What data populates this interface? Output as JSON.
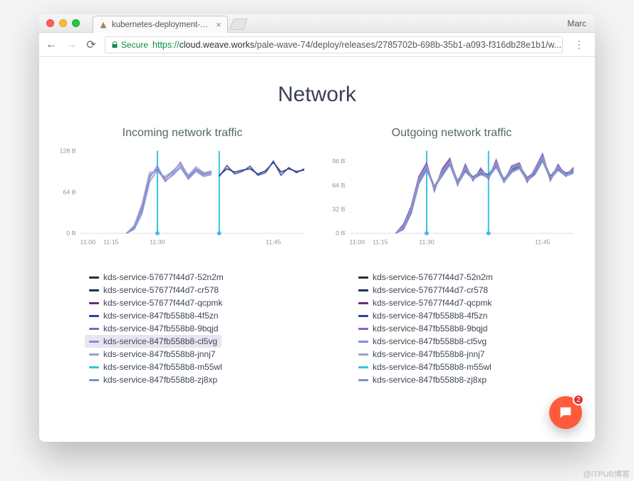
{
  "browser": {
    "user": "Marc",
    "tab_title": "kubernetes-deployment-strate",
    "secure_label": "Secure",
    "url_proto": "https://",
    "url_host": "cloud.weave.works",
    "url_path": "/pale-wave-74/deploy/releases/2785702b-698b-35b1-a093-f316db28e1b1/w..."
  },
  "page_title": "Network",
  "chat_badge": "2",
  "watermark": "@ITPUB博客",
  "legend_series": [
    {
      "name": "kds-service-57677f44d7-52n2m",
      "color": "#2b2b2b"
    },
    {
      "name": "kds-service-57677f44d7-cr578",
      "color": "#1f2d57"
    },
    {
      "name": "kds-service-57677f44d7-qcpmk",
      "color": "#6b2a7a"
    },
    {
      "name": "kds-service-847fb558b8-4f5zn",
      "color": "#2e3fa8"
    },
    {
      "name": "kds-service-847fb558b8-9bqjd",
      "color": "#8a5fc7"
    },
    {
      "name": "kds-service-847fb558b8-cl5vg",
      "color": "#7a8fe0"
    },
    {
      "name": "kds-service-847fb558b8-jnnj7",
      "color": "#9aa3c9"
    },
    {
      "name": "kds-service-847fb558b8-m55wl",
      "color": "#35c2e0"
    },
    {
      "name": "kds-service-847fb558b8-zj8xp",
      "color": "#7f90c8"
    }
  ],
  "selected_legend_incoming": "kds-service-847fb558b8-cl5vg",
  "chart_data": [
    {
      "type": "line",
      "title": "Incoming network traffic",
      "xlabel": "",
      "ylabel": "",
      "x_ticks": [
        "11:00",
        "11:15",
        "11:30",
        "11:45"
      ],
      "y_ticks": [
        "0 B",
        "64 B",
        "128 B"
      ],
      "ylim": [
        0,
        128
      ],
      "markers_x": [
        "11:30",
        "11:38"
      ],
      "x": [
        "10:55",
        "11:00",
        "11:05",
        "11:10",
        "11:15",
        "11:20",
        "11:25",
        "11:27",
        "11:28",
        "11:29",
        "11:30",
        "11:31",
        "11:32",
        "11:33",
        "11:34",
        "11:35",
        "11:36",
        "11:37",
        "11:38",
        "11:39",
        "11:40",
        "11:41",
        "11:42",
        "11:43",
        "11:44",
        "11:45",
        "11:46",
        "11:47",
        "11:48",
        "11:49"
      ],
      "series": [
        {
          "name": "kds-service-57677f44d7-52n2m",
          "color": "#2b2b2b",
          "values": [
            null,
            null,
            null,
            null,
            null,
            null,
            null,
            null,
            null,
            null,
            null,
            null,
            null,
            null,
            null,
            null,
            null,
            null,
            null,
            null,
            null,
            null,
            null,
            null,
            null,
            null,
            null,
            null,
            null,
            null
          ]
        },
        {
          "name": "kds-service-57677f44d7-cr578",
          "color": "#1f2d57",
          "values": [
            null,
            null,
            null,
            null,
            null,
            null,
            null,
            null,
            null,
            null,
            null,
            null,
            null,
            null,
            null,
            null,
            null,
            null,
            90,
            100,
            95,
            98,
            100,
            92,
            97,
            110,
            95,
            100,
            96,
            98
          ]
        },
        {
          "name": "kds-service-57677f44d7-qcpmk",
          "color": "#6b2a7a",
          "values": [
            null,
            null,
            null,
            null,
            null,
            null,
            null,
            null,
            null,
            null,
            null,
            null,
            null,
            null,
            null,
            null,
            null,
            null,
            null,
            null,
            null,
            null,
            null,
            null,
            null,
            null,
            null,
            null,
            null,
            null
          ]
        },
        {
          "name": "kds-service-847fb558b8-4f5zn",
          "color": "#2e3fa8",
          "values": [
            null,
            null,
            null,
            null,
            null,
            null,
            null,
            null,
            null,
            null,
            null,
            null,
            null,
            null,
            null,
            null,
            null,
            null,
            88,
            105,
            92,
            96,
            104,
            90,
            94,
            112,
            90,
            102,
            94,
            100
          ]
        },
        {
          "name": "kds-service-847fb558b8-9bqjd",
          "color": "#8a5fc7",
          "values": [
            null,
            null,
            null,
            null,
            null,
            null,
            0,
            10,
            40,
            90,
            100,
            85,
            95,
            110,
            88,
            100,
            92,
            95,
            null,
            null,
            null,
            null,
            null,
            null,
            null,
            null,
            null,
            null,
            null,
            null
          ]
        },
        {
          "name": "kds-service-847fb558b8-cl5vg",
          "color": "#7a8fe0",
          "values": [
            null,
            null,
            null,
            null,
            null,
            null,
            0,
            8,
            35,
            85,
            105,
            80,
            92,
            105,
            86,
            98,
            90,
            93,
            null,
            null,
            null,
            null,
            null,
            null,
            null,
            null,
            null,
            null,
            null,
            null
          ]
        },
        {
          "name": "kds-service-847fb558b8-jnnj7",
          "color": "#9aa3c9",
          "values": [
            null,
            null,
            null,
            null,
            null,
            null,
            0,
            12,
            45,
            95,
            95,
            88,
            97,
            108,
            90,
            103,
            94,
            97,
            null,
            null,
            null,
            null,
            null,
            null,
            null,
            null,
            null,
            null,
            null,
            null
          ]
        },
        {
          "name": "kds-service-847fb558b8-m55wl",
          "color": "#35c2e0",
          "values": [
            null,
            null,
            null,
            null,
            null,
            null,
            null,
            null,
            null,
            null,
            null,
            null,
            null,
            null,
            null,
            null,
            null,
            null,
            null,
            null,
            null,
            null,
            null,
            null,
            null,
            null,
            null,
            null,
            null,
            null
          ]
        },
        {
          "name": "kds-service-847fb558b8-zj8xp",
          "color": "#7f90c8",
          "values": [
            null,
            null,
            null,
            null,
            null,
            null,
            0,
            6,
            30,
            80,
            98,
            82,
            90,
            102,
            84,
            96,
            88,
            91,
            null,
            null,
            null,
            null,
            null,
            null,
            null,
            null,
            null,
            null,
            null,
            null
          ]
        }
      ]
    },
    {
      "type": "line",
      "title": "Outgoing network traffic",
      "xlabel": "",
      "ylabel": "",
      "x_ticks": [
        "11:00",
        "11:15",
        "11:30",
        "11:45"
      ],
      "y_ticks": [
        "0 B",
        "32 B",
        "64 B",
        "96 B"
      ],
      "ylim": [
        0,
        110
      ],
      "markers_x": [
        "11:30",
        "11:38"
      ],
      "x": [
        "10:55",
        "11:00",
        "11:05",
        "11:10",
        "11:15",
        "11:20",
        "11:25",
        "11:27",
        "11:28",
        "11:29",
        "11:30",
        "11:31",
        "11:32",
        "11:33",
        "11:34",
        "11:35",
        "11:36",
        "11:37",
        "11:38",
        "11:39",
        "11:40",
        "11:41",
        "11:42",
        "11:43",
        "11:44",
        "11:45",
        "11:46",
        "11:47",
        "11:48",
        "11:49"
      ],
      "series": [
        {
          "name": "kds-service-57677f44d7-52n2m",
          "color": "#2b2b2b",
          "values": [
            null,
            null,
            null,
            null,
            null,
            null,
            null,
            null,
            null,
            null,
            null,
            null,
            null,
            null,
            null,
            null,
            null,
            null,
            null,
            null,
            null,
            null,
            null,
            null,
            null,
            null,
            null,
            null,
            null,
            null
          ]
        },
        {
          "name": "kds-service-57677f44d7-cr578",
          "color": "#1f2d57",
          "values": [
            null,
            null,
            null,
            null,
            null,
            null,
            0,
            8,
            30,
            70,
            88,
            62,
            80,
            95,
            70,
            86,
            75,
            82,
            78,
            92,
            72,
            85,
            90,
            74,
            82,
            100,
            76,
            88,
            80,
            84
          ]
        },
        {
          "name": "kds-service-57677f44d7-qcpmk",
          "color": "#6b2a7a",
          "values": [
            null,
            null,
            null,
            null,
            null,
            null,
            0,
            10,
            34,
            74,
            92,
            58,
            84,
            98,
            68,
            90,
            72,
            85,
            74,
            96,
            70,
            88,
            92,
            70,
            85,
            104,
            72,
            90,
            78,
            86
          ]
        },
        {
          "name": "kds-service-847fb558b8-4f5zn",
          "color": "#2e3fa8",
          "values": [
            null,
            null,
            null,
            null,
            null,
            null,
            0,
            6,
            28,
            68,
            86,
            60,
            78,
            93,
            66,
            84,
            73,
            80,
            76,
            90,
            70,
            83,
            88,
            72,
            80,
            98,
            74,
            86,
            78,
            82
          ]
        },
        {
          "name": "kds-service-847fb558b8-9bqjd",
          "color": "#8a5fc7",
          "values": [
            null,
            null,
            null,
            null,
            null,
            null,
            0,
            12,
            36,
            76,
            94,
            56,
            86,
            100,
            64,
            92,
            70,
            87,
            72,
            98,
            68,
            90,
            94,
            68,
            86,
            106,
            70,
            92,
            76,
            88
          ]
        },
        {
          "name": "kds-service-847fb558b8-cl5vg",
          "color": "#7a8fe0",
          "values": [
            null,
            null,
            null,
            null,
            null,
            null,
            0,
            7,
            29,
            69,
            87,
            61,
            79,
            94,
            67,
            85,
            74,
            81,
            77,
            91,
            71,
            84,
            89,
            73,
            81,
            99,
            75,
            87,
            79,
            83
          ]
        },
        {
          "name": "kds-service-847fb558b8-jnnj7",
          "color": "#9aa3c9",
          "values": [
            null,
            null,
            null,
            null,
            null,
            null,
            0,
            9,
            32,
            72,
            90,
            59,
            82,
            96,
            69,
            88,
            73,
            83,
            75,
            94,
            69,
            87,
            91,
            71,
            84,
            102,
            73,
            89,
            77,
            85
          ]
        },
        {
          "name": "kds-service-847fb558b8-m55wl",
          "color": "#35c2e0",
          "values": [
            null,
            null,
            null,
            null,
            null,
            null,
            null,
            null,
            null,
            null,
            null,
            null,
            null,
            null,
            null,
            null,
            null,
            null,
            null,
            null,
            null,
            null,
            null,
            null,
            null,
            null,
            null,
            null,
            null,
            null
          ]
        },
        {
          "name": "kds-service-847fb558b8-zj8xp",
          "color": "#7f90c8",
          "values": [
            null,
            null,
            null,
            null,
            null,
            null,
            0,
            5,
            26,
            66,
            84,
            62,
            76,
            91,
            65,
            82,
            72,
            78,
            74,
            88,
            68,
            81,
            86,
            70,
            78,
            96,
            72,
            84,
            76,
            80
          ]
        }
      ]
    }
  ]
}
